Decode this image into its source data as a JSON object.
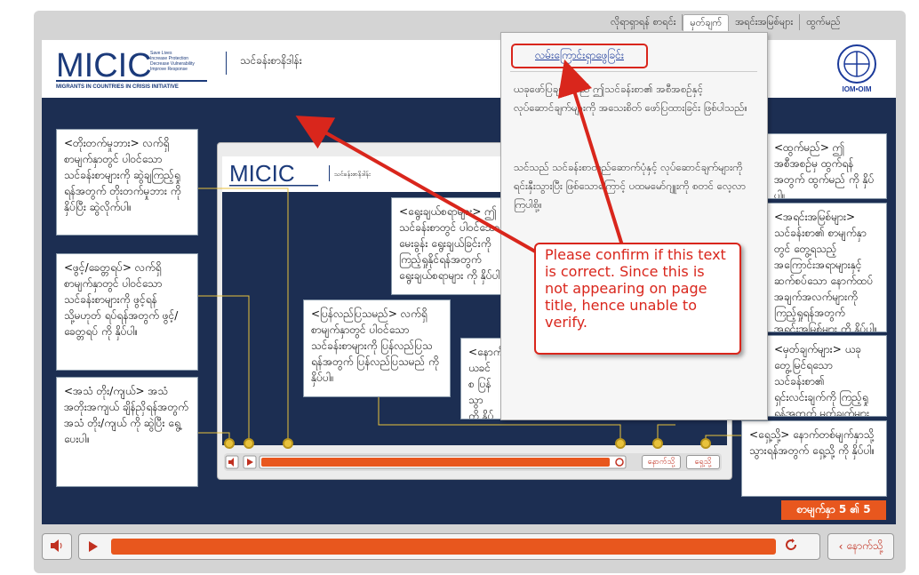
{
  "nav": {
    "items": [
      {
        "label": "လိုရာရှာရန် စာရင်း",
        "active": false
      },
      {
        "label": "မှတ်ချက်",
        "active": true
      },
      {
        "label": "အရင်းအမြစ်များ",
        "active": false
      },
      {
        "label": "ထွက်မည်",
        "active": false
      }
    ]
  },
  "header": {
    "logo_text": "MICIC",
    "logo_tagline": [
      "Save Lives",
      "Increase Protection",
      "Decrease Vulnerability",
      "Improve Response"
    ],
    "logo_subtitle": "MIGRANTS IN COUNTRIES IN CRISIS INITIATIVE",
    "module_title": "သင်ခန်းစာနိဒါန်း",
    "iom_label": "IOM•OIM"
  },
  "notes": {
    "menu": "<တိုးတက်မှုဘား> လက်ရှိစာမျက်နှာတွင် ပါဝင်သော သင်ခန်းစာများကို ဆွဲချကြည့်ရှုရန်အတွက် တိုးတက်မှုဘား ကို နှိပ်ပြီး ဆွဲလိုက်ပါ။",
    "play_pause": "<ဖွင့်/ခေတ္တရပ်> လက်ရှိစာမျက်နှာတွင် ပါဝင်သော သင်ခန်းစာများကို ဖွင့်ရန် သို့မဟုတ် ရပ်ရန်အတွက် ဖွင့်/ခေတ္တရပ် ကို နှိပ်ပါ။",
    "audio": "<အသံ တိုး/ကျယ်> အသံအတိုးအကျယ် ချိန်ညှိရန်အတွက် အသံ တိုး/ကျယ် ကို ဆွဲပြီး ရွေ့ပေးပါ။",
    "select": "<ရွေးချယ်စရာများ> ဤသင်ခန်းစာတွင် ပါဝင်သော မေးခွန်း ရွေးချယ်ခြင်းကို ကြည့်ရှုနိုင်ရန်အတွက် ရွေးချယ်စရာများ ကို နှိပ်ပါ။",
    "replay": "<ပြန်လည်ပြသမည်> လက်ရှိစာမျက်နှာတွင် ပါဝင်သော သင်ခန်းစာများကို ပြန်လည်ပြသရန်အတွက် ပြန်လည်ပြသမည် ကို နှိပ်ပါ။",
    "back_partial": "<နောက် ယခင်စ ပြန်သွာ ကို နှိပ်",
    "exit": "<ထွက်မည်> ဤအစီအစဉ်မှ ထွက်ရန်အတွက် ထွက်မည် ကို နှိပ်ပါ။",
    "resources": "<အရင်းအမြစ်များ> သင်ခန်းစာ၏ စာမျက်နှာတွင် တွေ့ရသည့် အကြောင်းအရာများနှင့် ဆက်စပ်သော နောက်ထပ် အချက်အလက်များကို ကြည့်ရှုရန်အတွက် အရင်းအမြစ်များ ကို နှိပ်ပါ။",
    "comments": "<မှတ်ချက်များ> ယခုတွေ့မြင်ရသော သင်ခန်းစာ၏ ရှင်းလင်းချက်ကို ကြည့်ရှုရန်အတွက် မှတ်ချက်များ ကို နှိပ်ပါ။",
    "forward": "<ရှေ့သို့> နောက်တစ်မျက်နှာသို့ သွားရန်အတွက် ရှေ့သို့ ကို နှိပ်ပါ။"
  },
  "popup": {
    "heading": "လမ်းကြောင်းရှာဖွေခြင်း",
    "text1": "ယခုဖော်ပြချက်သည် ဤသင်ခန်းစာ၏ အစီအစဉ်နှင့် လုပ်ဆောင်ချက်များကို အသေးစိတ် ဖော်ပြထားခြင်း ဖြစ်ပါသည်။",
    "text2": "သင်သည် သင်ခန်းစာတည်ဆောက်ပုံနှင့် လုပ်ဆောင်ချက်များကို ရင်းနှီးသွားပြီး ဖြစ်သောကြောင့် ပထမမော်ဂျူးကို စတင် လေ့လာကြပါစို့။"
  },
  "comment": {
    "text": "Please confirm if this text is correct. Since this is not appearing on page title, hence unable to verify."
  },
  "inner": {
    "logo_text": "MICIC",
    "module_title": "သင်ခန်းစာနိဒါန်း",
    "back_label": "နောက်သို့",
    "next_label": "ရှေ့သို့"
  },
  "page_count": "စာမျက်နှာ 5 ၏ 5",
  "controls": {
    "back_label": "နောက်သို့",
    "progress": 1.0
  },
  "colors": {
    "accent": "#e8571e",
    "navy": "#1c2e52",
    "annotation_red": "#d9261c"
  }
}
